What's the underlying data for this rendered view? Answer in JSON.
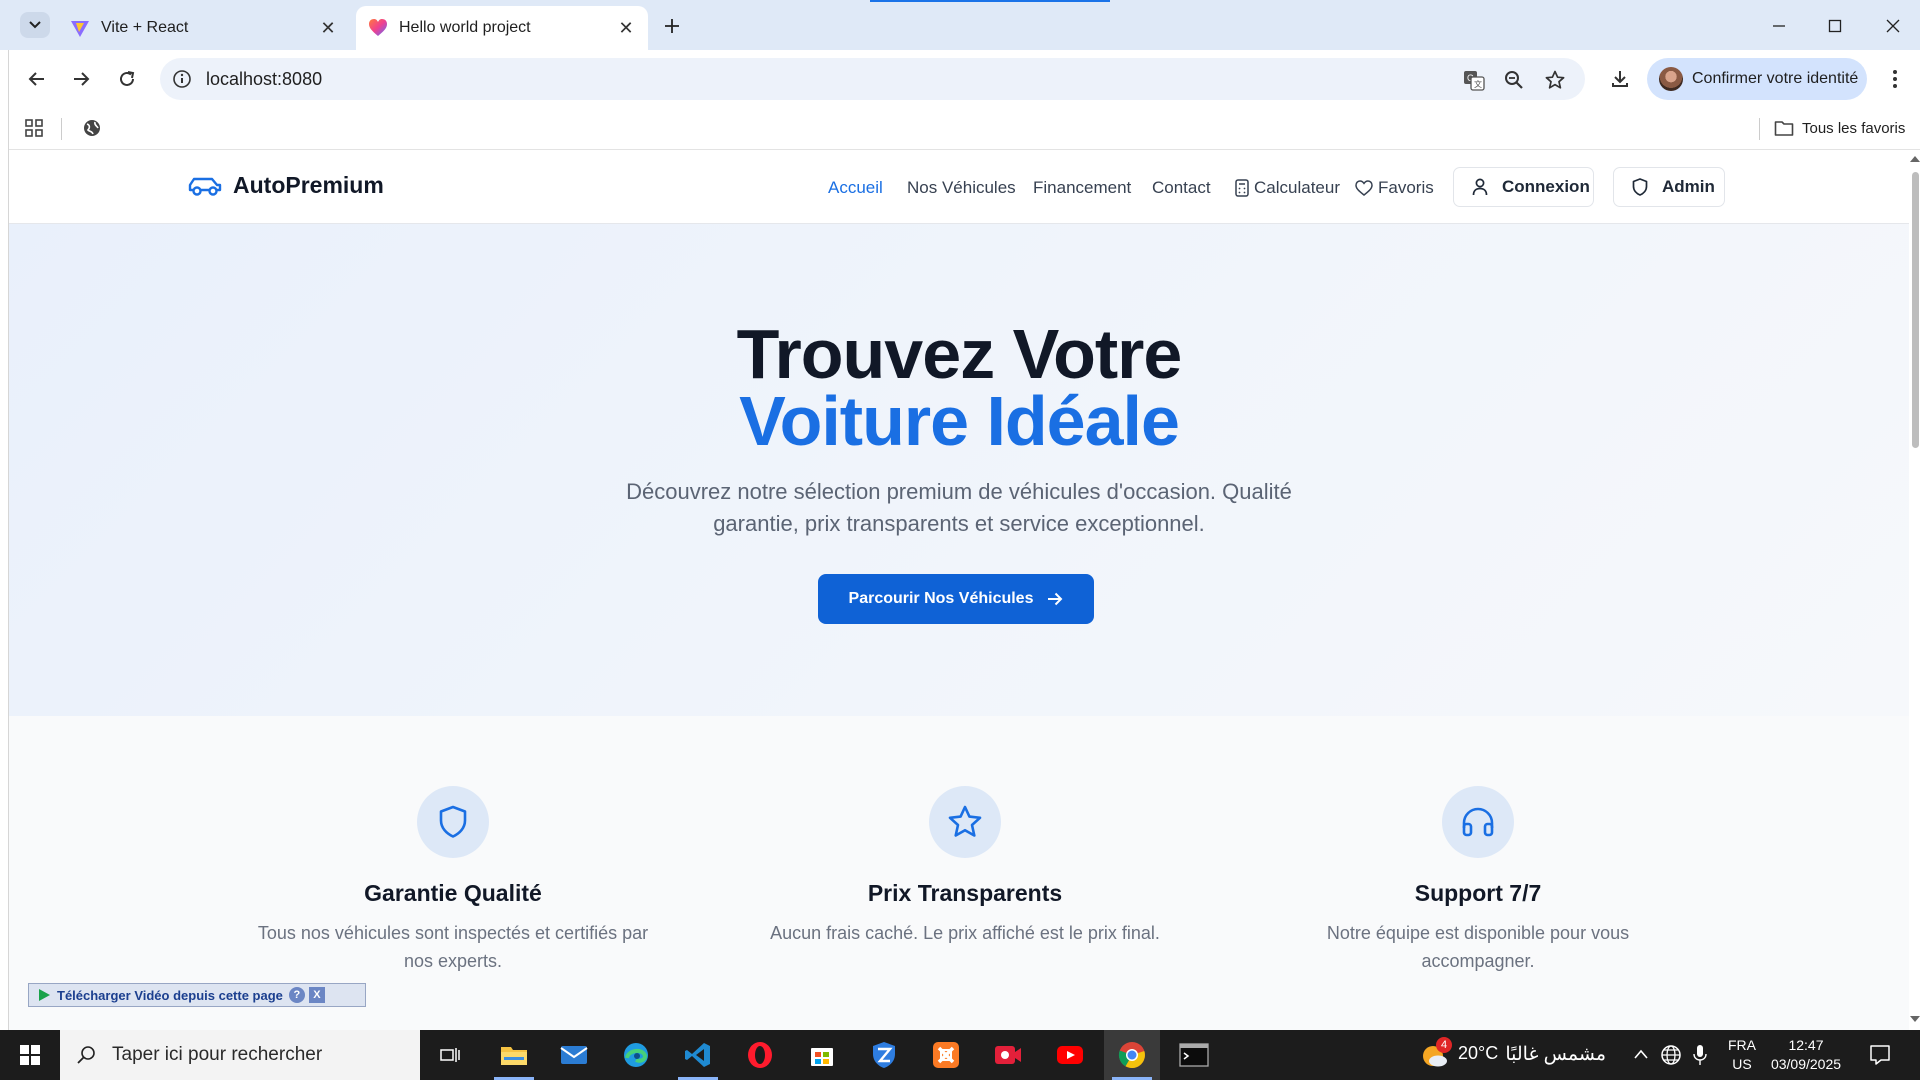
{
  "browser": {
    "tabs": [
      {
        "title": "Vite + React",
        "active": false
      },
      {
        "title": "Hello world project",
        "active": true
      }
    ],
    "url": "localhost:8080",
    "profile_label": "Confirmer votre identité",
    "bookmarks_label": "Tous les favoris"
  },
  "site": {
    "logo": "AutoPremium",
    "nav": [
      "Accueil",
      "Nos Véhicules",
      "Financement",
      "Contact",
      "Calculateur",
      "Favoris"
    ],
    "login": "Connexion",
    "admin": "Admin"
  },
  "hero": {
    "title_line1": "Trouvez Votre",
    "title_line2": "Voiture Idéale",
    "lead": "Découvrez notre sélection premium de véhicules d'occasion. Qualité garantie, prix transparents et service exceptionnel.",
    "cta": "Parcourir Nos Véhicules"
  },
  "features": [
    {
      "icon": "shield-icon",
      "title": "Garantie Qualité",
      "desc": "Tous nos véhicules sont inspectés et certifiés par nos experts."
    },
    {
      "icon": "star-icon",
      "title": "Prix Transparents",
      "desc": "Aucun frais caché. Le prix affiché est le prix final."
    },
    {
      "icon": "headphones-icon",
      "title": "Support 7/7",
      "desc": "Notre équipe est disponible pour vous accompagner."
    }
  ],
  "download_bar": {
    "label": "Télécharger Vidéo depuis cette page",
    "help": "?",
    "close": "X"
  },
  "taskbar": {
    "search_placeholder": "Taper ici pour rechercher",
    "weather_badge": "4",
    "temperature": "20°C",
    "weather_text": "مشمس غالبًا",
    "lang_top": "FRA",
    "lang_bottom": "US",
    "time": "12:47",
    "date": "03/09/2025"
  },
  "colors": {
    "accent": "#1a6fe3",
    "cta": "#0f62d6",
    "chrome_tabbar": "#dfe9f7"
  }
}
